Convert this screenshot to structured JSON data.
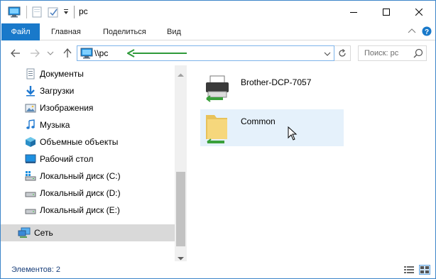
{
  "titlebar": {
    "title": "pc"
  },
  "ribbon": {
    "tabs": [
      {
        "label": "Файл",
        "active": true
      },
      {
        "label": "Главная"
      },
      {
        "label": "Поделиться"
      },
      {
        "label": "Вид"
      }
    ]
  },
  "address": {
    "path": "\\\\pc"
  },
  "search": {
    "placeholder": "Поиск: pc"
  },
  "nav": {
    "items": [
      {
        "label": "Документы",
        "icon": "documents-icon"
      },
      {
        "label": "Загрузки",
        "icon": "downloads-icon"
      },
      {
        "label": "Изображения",
        "icon": "pictures-icon"
      },
      {
        "label": "Музыка",
        "icon": "music-icon"
      },
      {
        "label": "Объемные объекты",
        "icon": "3d-objects-icon"
      },
      {
        "label": "Рабочий стол",
        "icon": "desktop-icon"
      },
      {
        "label": "Локальный диск (C:)",
        "icon": "drive-icon"
      },
      {
        "label": "Локальный диск (D:)",
        "icon": "drive-icon"
      },
      {
        "label": "Локальный диск (E:)",
        "icon": "drive-icon"
      },
      {
        "label": "Сеть",
        "icon": "network-icon",
        "selected": true
      }
    ]
  },
  "content": {
    "items": [
      {
        "label": "Brother-DCP-7057",
        "icon": "shared-printer-icon"
      },
      {
        "label": "Common",
        "icon": "shared-folder-icon",
        "hovered": true
      }
    ]
  },
  "status": {
    "count_text": "Элементов: 2"
  },
  "colors": {
    "accent": "#1979ca",
    "selection": "#d9d9d9",
    "hover": "#e5f1fb",
    "annotation_arrow": "#2e9a3a"
  }
}
